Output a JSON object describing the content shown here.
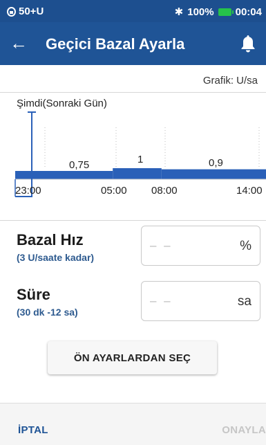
{
  "status_bar": {
    "signal_text": "50+U",
    "bluetooth_symbol": "✱",
    "battery_percent": "100%",
    "time": "00:04",
    "battery_color": "#26c24a"
  },
  "app_bar": {
    "title": "Geçici Bazal Ayarla",
    "back_icon": "←",
    "bell_icon": "bell-icon"
  },
  "graph_unit_label": "Grafik: U/sa",
  "chart_data": {
    "type": "area",
    "title": "",
    "now_label": "Şimdi(Sonraki Gün)",
    "x_ticks": [
      "23:00",
      "05:00",
      "08:00",
      "14:00"
    ],
    "segments": [
      {
        "start": "23:00",
        "end": "05:00",
        "rate_label": "0,75",
        "rate": 0.75
      },
      {
        "start": "05:00",
        "end": "08:00",
        "rate_label": "1",
        "rate": 1
      },
      {
        "start": "08:00",
        "end": "14:00",
        "rate_label": "0,9",
        "rate": 0.9
      }
    ],
    "bar_color": "#2a60b8"
  },
  "basal_rate": {
    "label": "Bazal Hız",
    "sublabel": "(3 U/saate kadar)",
    "placeholder": "– –",
    "unit": "%"
  },
  "duration": {
    "label": "Süre",
    "sublabel": "(30 dk -12 sa)",
    "placeholder": "– –",
    "unit": "sa"
  },
  "preset_button": "ÖN AYARLARDAN SEÇ",
  "bottom_bar": {
    "cancel": "İPTAL",
    "confirm": "ONAYLA"
  }
}
